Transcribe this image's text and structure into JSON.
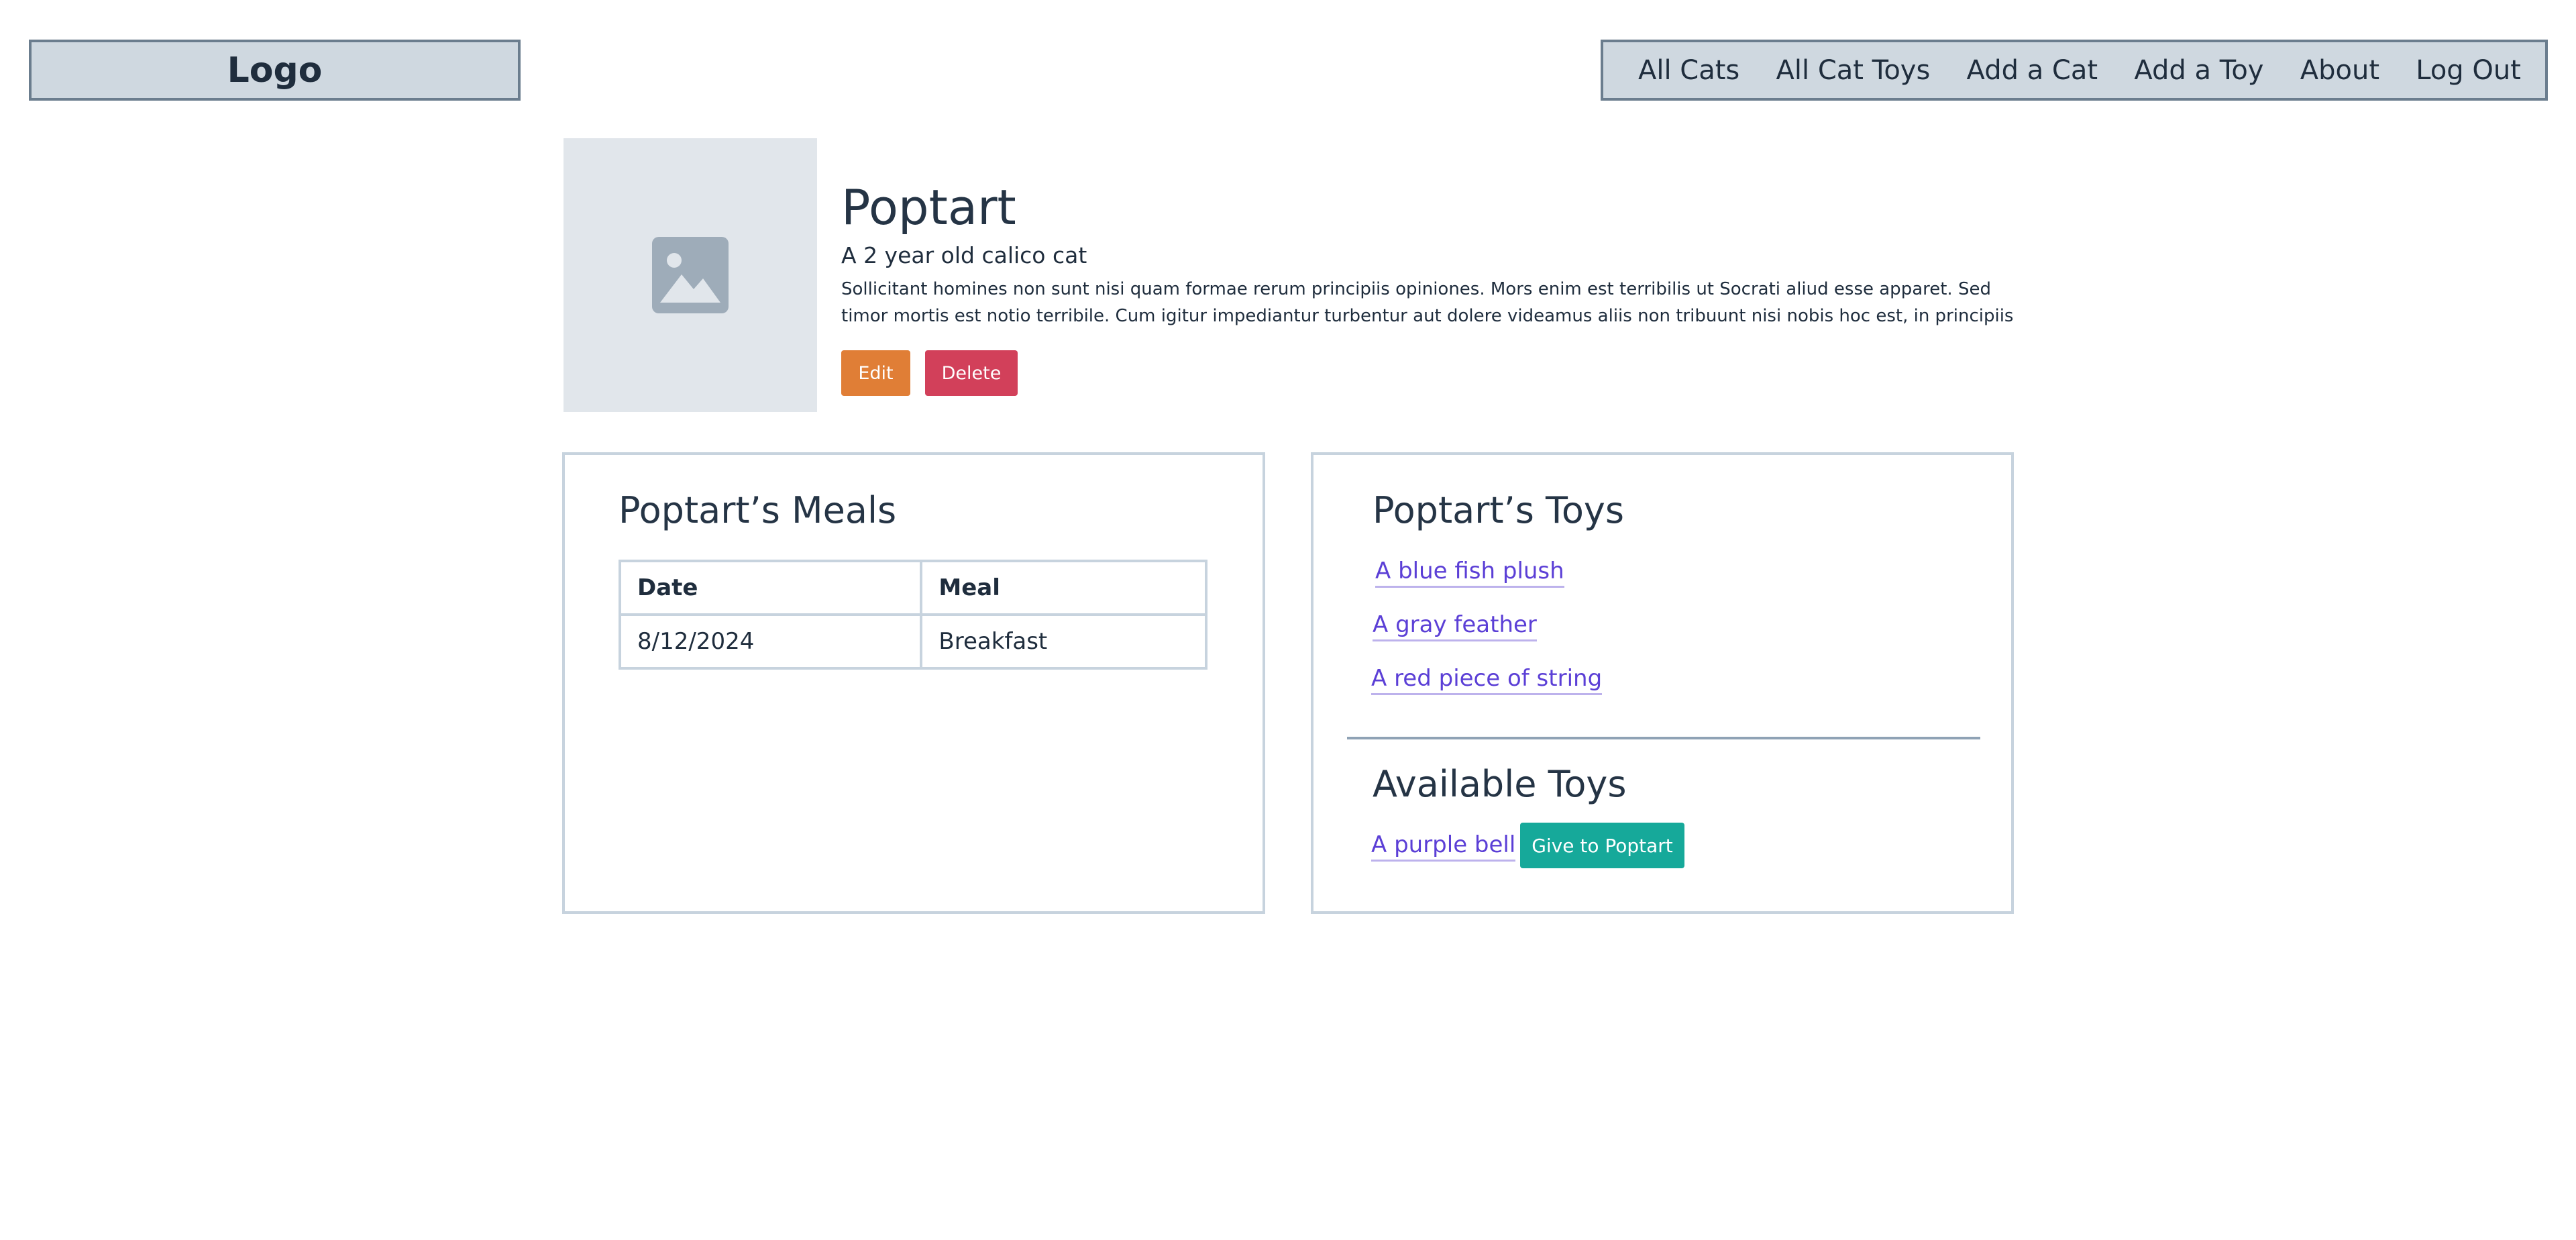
{
  "header": {
    "logo": "Logo",
    "nav": [
      "All Cats",
      "All Cat Toys",
      "Add a Cat",
      "Add a Toy",
      "About",
      "Log Out"
    ]
  },
  "cat": {
    "name": "Poptart",
    "subtitle": "A 2 year old calico cat",
    "description": "Sollicitant homines non sunt nisi quam formae rerum principiis opiniones. Mors enim est terribilis ut Socrati aliud esse apparet. Sed timor mortis est notio terribile. Cum igitur impediantur turbentur aut dolere videamus aliis non tribuunt nisi nobis hoc est, in principiis",
    "edit_label": "Edit",
    "delete_label": "Delete"
  },
  "meals": {
    "title": "Poptart’s Meals",
    "columns": [
      "Date",
      "Meal"
    ],
    "rows": [
      [
        "8/12/2024",
        "Breakfast"
      ]
    ]
  },
  "toys": {
    "title": "Poptart’s Toys",
    "items": [
      "A blue fish plush",
      "A gray feather",
      "A red piece of string"
    ],
    "available_title": "Available Toys",
    "available": [
      {
        "name": "A purple bell",
        "action": "Give to Poptart"
      }
    ]
  },
  "colors": {
    "edit": "#e07e36",
    "delete": "#d2405a",
    "give": "#16a99a",
    "link": "#5b3fd6"
  },
  "icons": {
    "hero": "image-placeholder-icon"
  }
}
